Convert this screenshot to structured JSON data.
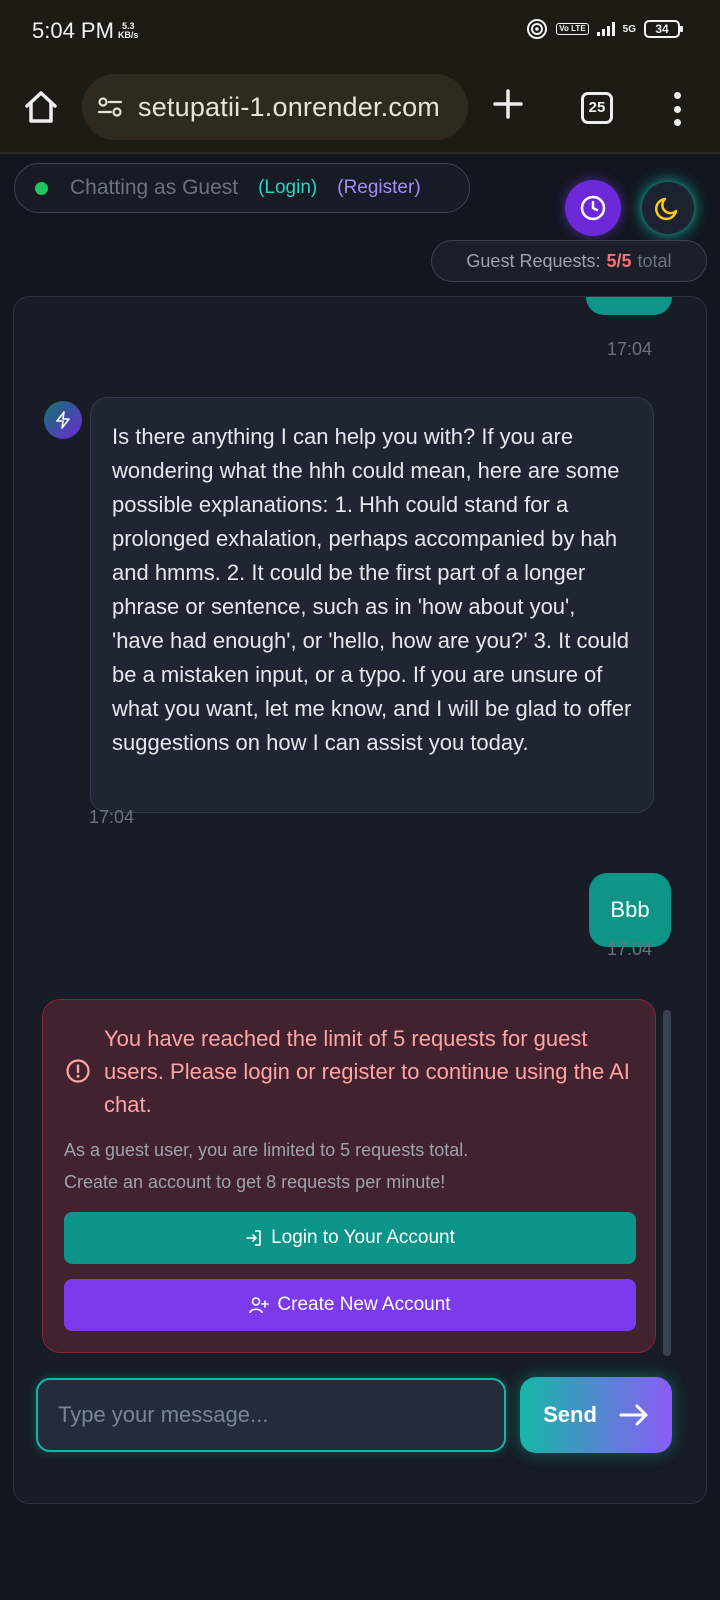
{
  "status_bar": {
    "time": "5:04 PM",
    "net_speed_value": "5.3",
    "net_speed_unit": "KB/s",
    "volte": "Vo LTE",
    "network": "5G",
    "battery": "34"
  },
  "browser": {
    "url": "setupatii-1.onrender.com",
    "tab_count": "25"
  },
  "header": {
    "guest_status": "Chatting as Guest",
    "login_link": "(Login)",
    "register_link": "(Register)",
    "requests_label": "Guest Requests:",
    "requests_count": "5/5",
    "requests_suffix": "total"
  },
  "chat": {
    "messages": [
      {
        "role": "user",
        "text": "",
        "time": "17:04"
      },
      {
        "role": "assistant",
        "text": "Is there anything I can help you with? If you are wondering what the hhh could mean, here are some possible explanations: 1. Hhh could stand for a prolonged exhalation, perhaps accompanied by hah and hmms. 2. It could be the first part of a longer phrase or sentence, such as in 'how about you', 'have had enough', or 'hello, how are you?' 3. It could be a mistaken input, or a typo. If you are unsure of what you want, let me know, and I will be glad to offer suggestions on how I can assist you today.",
        "time": "17:04"
      },
      {
        "role": "user",
        "text": "Bbb",
        "time": "17:04"
      }
    ]
  },
  "limit_notice": {
    "title": "You have reached the limit of 5 requests for guest users. Please login or register to continue using the AI chat.",
    "line1": "As a guest user, you are limited to 5 requests total.",
    "line2": "Create an account to get 8 requests per minute!",
    "login_button": "Login to Your Account",
    "register_button": "Create New Account"
  },
  "composer": {
    "placeholder": "Type your message...",
    "value": "",
    "send_label": "Send"
  },
  "colors": {
    "teal": "#0d9488",
    "purple": "#7c3aed",
    "error_text": "#fca5a5",
    "background": "#12161f"
  }
}
